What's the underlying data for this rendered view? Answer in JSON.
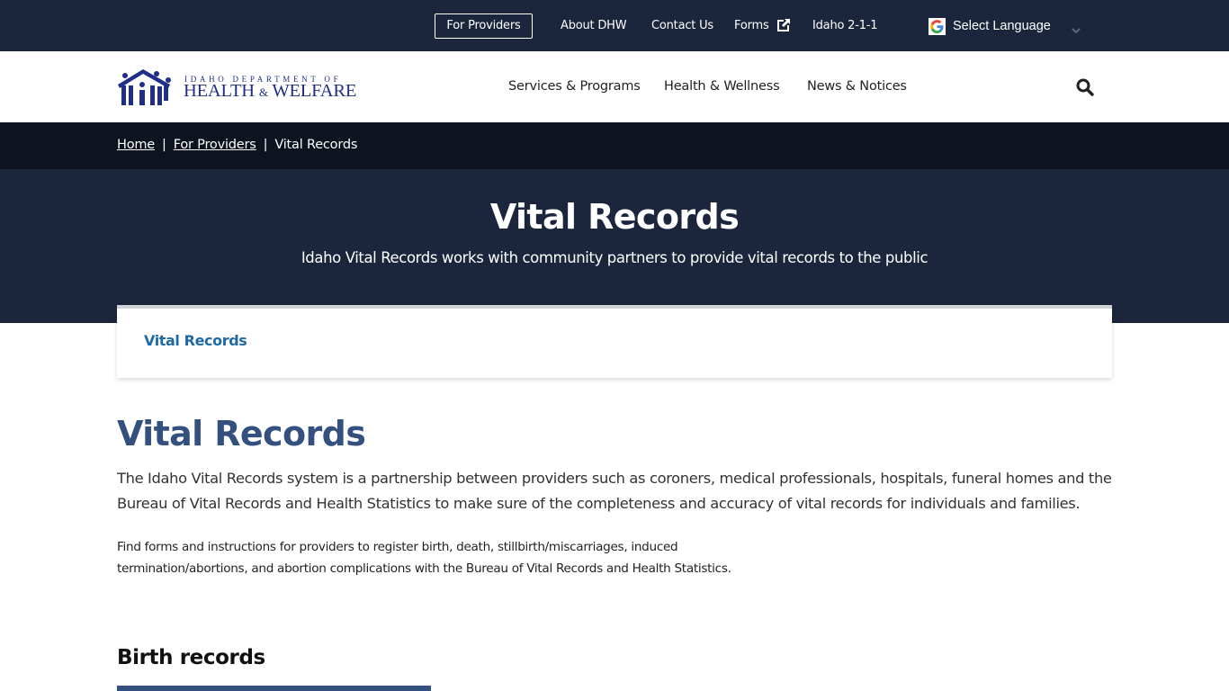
{
  "utility_nav": {
    "providers_button": "For Providers",
    "links": [
      "About DHW",
      "Contact Us",
      "Forms",
      "Idaho 2-1-1"
    ],
    "forms_icon": "external-link-icon",
    "language": {
      "icon": "google-icon",
      "label": "Select Language",
      "chevron": "chevron-down-icon"
    }
  },
  "header": {
    "logo": {
      "line1": "IDAHO DEPARTMENT OF",
      "line2a": "HEALTH",
      "amp": "&",
      "line2b": "WELFARE",
      "icon": "family-house-icon"
    },
    "nav": [
      "Services & Programs",
      "Health & Wellness",
      "News & Notices"
    ],
    "search_icon": "search-icon"
  },
  "breadcrumb": {
    "items": [
      "Home",
      "For Providers",
      "Vital Records"
    ],
    "separator": "|"
  },
  "hero": {
    "title": "Vital Records",
    "subtitle": "Idaho Vital Records works with community partners to provide vital records to the public"
  },
  "card": {
    "link": "Vital Records"
  },
  "content": {
    "title": "Vital Records",
    "lead": "The Idaho Vital Records system is a partnership between providers such as coroners, medical professionals, hospitals, funeral homes and the Bureau of Vital Records and Health Statistics to make sure of the completeness and accuracy of vital records for individuals and families.",
    "paragraph": "Find forms and instructions for providers to register birth, death, stillbirth/miscarriages, induced termination/abortions, and abortion complications with the Bureau of Vital Records and Health Statistics.",
    "section_heading": "Birth records"
  },
  "colors": {
    "utility_bg": "#1b263d",
    "breadcrumb_bg": "#0d131f",
    "hero_bg": "#1b263d",
    "logo_blue": "#1f2e86",
    "heading_blue": "#34507f",
    "link_blue": "#1f6aa5"
  }
}
